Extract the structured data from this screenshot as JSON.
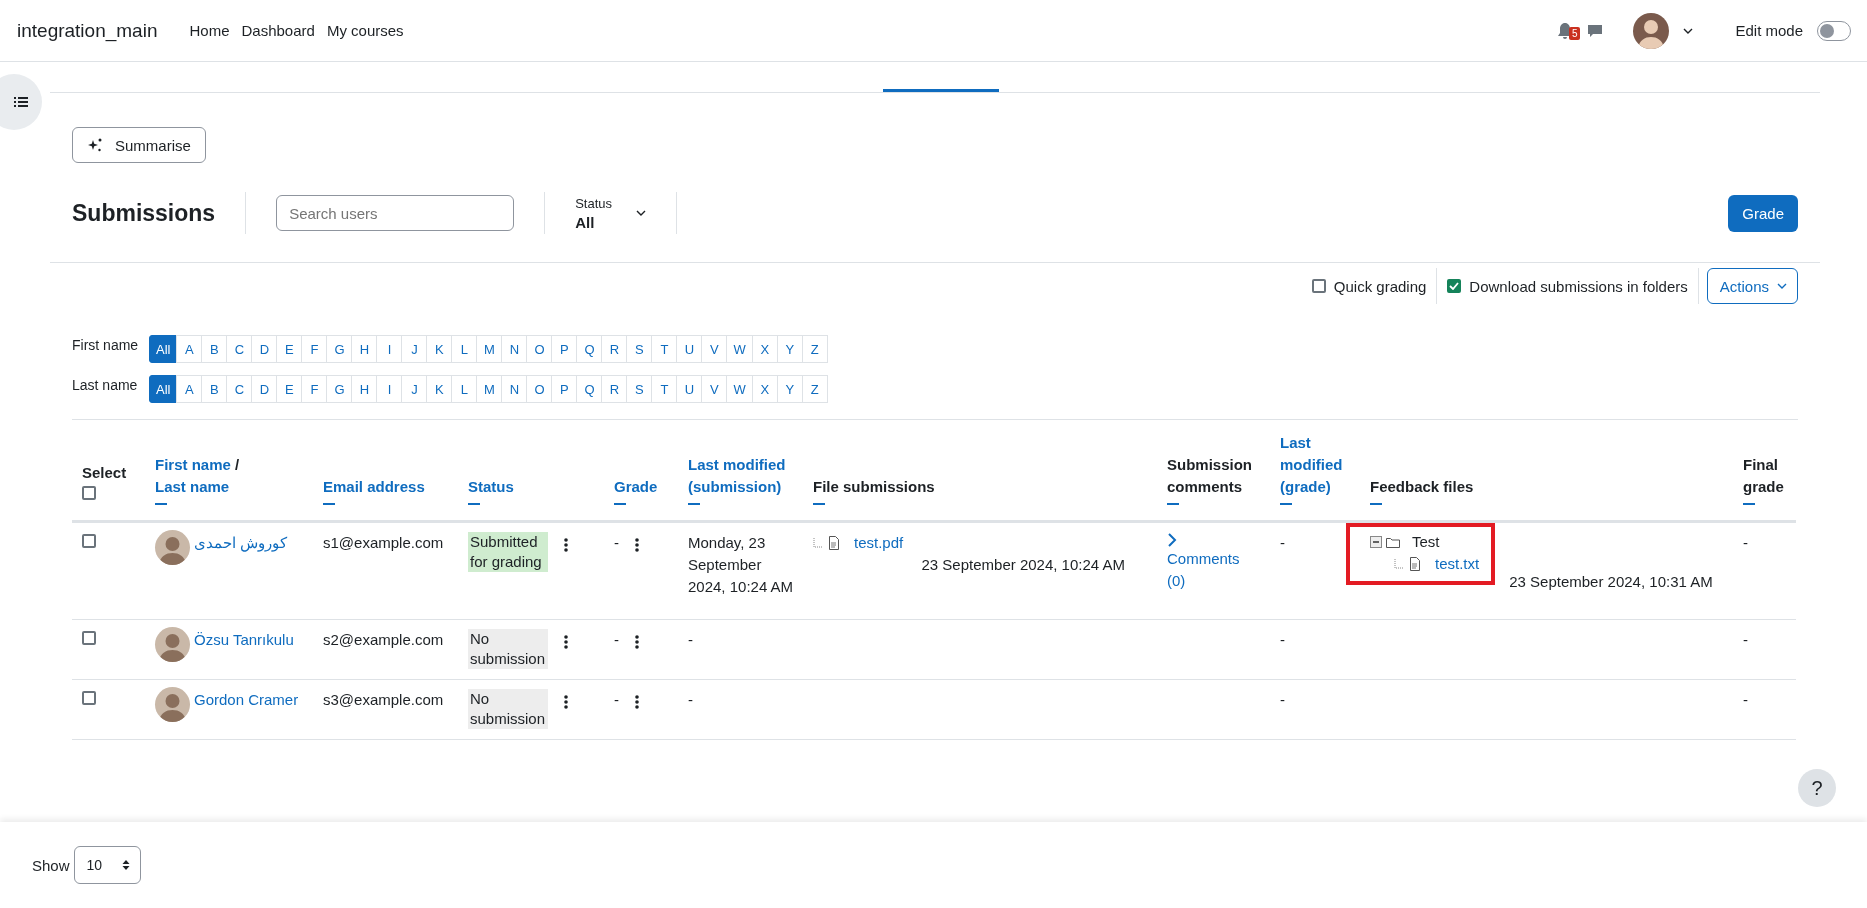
{
  "header": {
    "site_name": "integration_main",
    "nav": [
      {
        "label": "Home"
      },
      {
        "label": "Dashboard"
      },
      {
        "label": "My courses"
      }
    ],
    "notification_count": "5",
    "edit_mode": {
      "label": "Edit mode",
      "on": false
    }
  },
  "tabs": [
    {
      "selected": false
    },
    {
      "selected": false
    },
    {
      "selected": true
    },
    {
      "selected": false
    },
    {
      "selected": false
    }
  ],
  "summarise_button": "Summarise",
  "title": "Submissions",
  "search": {
    "placeholder": "Search users"
  },
  "status_filter": {
    "label": "Status",
    "value": "All"
  },
  "grade_button": "Grade",
  "options": [
    {
      "label": "Quick grading",
      "checked": false
    },
    {
      "label": "Download submissions in folders",
      "checked": true
    }
  ],
  "actions_button": "Actions",
  "initials_filters": [
    {
      "label": "First name",
      "letters": [
        {
          "label": "All",
          "selected": true
        },
        {
          "label": "A",
          "selected": false
        },
        {
          "label": "B",
          "selected": false
        },
        {
          "label": "C",
          "selected": false
        },
        {
          "label": "D",
          "selected": false
        },
        {
          "label": "E",
          "selected": false
        },
        {
          "label": "F",
          "selected": false
        },
        {
          "label": "G",
          "selected": false
        },
        {
          "label": "H",
          "selected": false
        },
        {
          "label": "I",
          "selected": false
        },
        {
          "label": "J",
          "selected": false
        },
        {
          "label": "K",
          "selected": false
        },
        {
          "label": "L",
          "selected": false
        },
        {
          "label": "M",
          "selected": false
        },
        {
          "label": "N",
          "selected": false
        },
        {
          "label": "O",
          "selected": false
        },
        {
          "label": "P",
          "selected": false
        },
        {
          "label": "Q",
          "selected": false
        },
        {
          "label": "R",
          "selected": false
        },
        {
          "label": "S",
          "selected": false
        },
        {
          "label": "T",
          "selected": false
        },
        {
          "label": "U",
          "selected": false
        },
        {
          "label": "V",
          "selected": false
        },
        {
          "label": "W",
          "selected": false
        },
        {
          "label": "X",
          "selected": false
        },
        {
          "label": "Y",
          "selected": false
        },
        {
          "label": "Z",
          "selected": false
        }
      ]
    },
    {
      "label": "Last name",
      "letters": [
        {
          "label": "All",
          "selected": true
        },
        {
          "label": "A",
          "selected": false
        },
        {
          "label": "B",
          "selected": false
        },
        {
          "label": "C",
          "selected": false
        },
        {
          "label": "D",
          "selected": false
        },
        {
          "label": "E",
          "selected": false
        },
        {
          "label": "F",
          "selected": false
        },
        {
          "label": "G",
          "selected": false
        },
        {
          "label": "H",
          "selected": false
        },
        {
          "label": "I",
          "selected": false
        },
        {
          "label": "J",
          "selected": false
        },
        {
          "label": "K",
          "selected": false
        },
        {
          "label": "L",
          "selected": false
        },
        {
          "label": "M",
          "selected": false
        },
        {
          "label": "N",
          "selected": false
        },
        {
          "label": "O",
          "selected": false
        },
        {
          "label": "P",
          "selected": false
        },
        {
          "label": "Q",
          "selected": false
        },
        {
          "label": "R",
          "selected": false
        },
        {
          "label": "S",
          "selected": false
        },
        {
          "label": "T",
          "selected": false
        },
        {
          "label": "U",
          "selected": false
        },
        {
          "label": "V",
          "selected": false
        },
        {
          "label": "W",
          "selected": false
        },
        {
          "label": "X",
          "selected": false
        },
        {
          "label": "Y",
          "selected": false
        },
        {
          "label": "Z",
          "selected": false
        }
      ]
    }
  ],
  "table": {
    "columns": [
      {
        "kind": "select",
        "label": "Select",
        "collapsible": false,
        "checked": false
      },
      {
        "kind": "name",
        "parts": [
          "First name",
          "Last name"
        ],
        "separator": "/",
        "collapsible": true
      },
      {
        "kind": "sortable",
        "label": "Email address",
        "collapsible": true
      },
      {
        "kind": "sortable",
        "label": "Status",
        "collapsible": true
      },
      {
        "kind": "sortable",
        "label": "Grade",
        "collapsible": true
      },
      {
        "kind": "sortable",
        "label": "Last modified (submission)",
        "collapsible": true
      },
      {
        "kind": "plain",
        "label": "File submissions",
        "collapsible": true
      },
      {
        "kind": "plain",
        "label": "Submission comments",
        "collapsible": true
      },
      {
        "kind": "sortable",
        "label": "Last modified (grade)",
        "collapsible": true
      },
      {
        "kind": "plain",
        "label": "Feedback files",
        "collapsible": true
      },
      {
        "kind": "plain",
        "label": "Final grade",
        "collapsible": true
      }
    ],
    "rows": [
      {
        "checked": false,
        "name": "کوروش احمدی",
        "email": "s1@example.com",
        "status": {
          "text": "Submitted for grading",
          "kind": "submitted"
        },
        "grade": "-",
        "last_modified": "Monday, 23 September 2024, 10:24 AM",
        "file_submissions": {
          "files": [
            "test.pdf"
          ],
          "date": "23 September 2024, 10:24 AM"
        },
        "comments": {
          "label": "Comments (0)"
        },
        "last_modified_grade": "-",
        "feedback_files": {
          "folder": "Test",
          "expanded": true,
          "files": [
            "test.txt"
          ],
          "highlighted": true,
          "date": "23 September 2024, 10:31 AM"
        },
        "final_grade": "-"
      },
      {
        "checked": false,
        "name": "Özsu Tanrıkulu",
        "email": "s2@example.com",
        "status": {
          "text": "No submission",
          "kind": "none"
        },
        "grade": "-",
        "last_modified": "-",
        "last_modified_grade": "-",
        "final_grade": "-"
      },
      {
        "checked": false,
        "name": "Gordon Cramer",
        "email": "s3@example.com",
        "status": {
          "text": "No submission",
          "kind": "none"
        },
        "grade": "-",
        "last_modified": "-",
        "last_modified_grade": "-",
        "final_grade": "-"
      }
    ]
  },
  "footer": {
    "show_label": "Show",
    "per_page": "10"
  },
  "help_button": "?"
}
